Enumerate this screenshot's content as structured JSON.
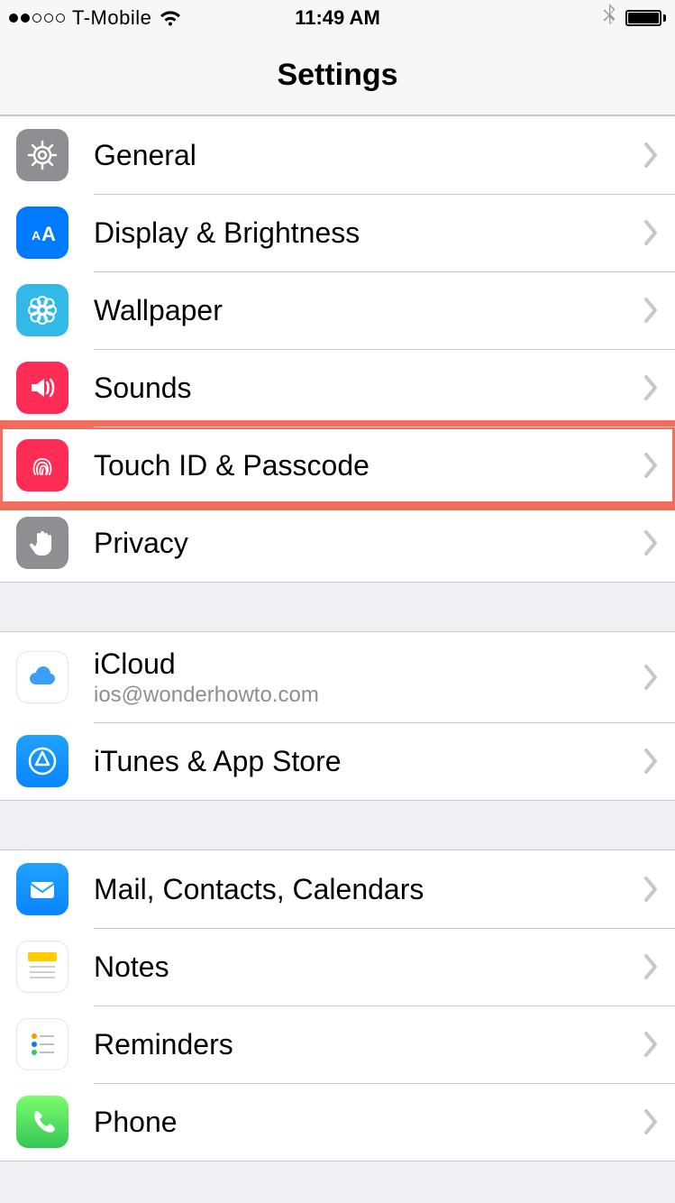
{
  "status": {
    "carrier": "T-Mobile",
    "time": "11:49 AM"
  },
  "header": {
    "title": "Settings"
  },
  "groups": [
    {
      "rows": [
        {
          "id": "general",
          "label": "General",
          "icon": "gear-icon",
          "bg": "bg-gray",
          "highlight": false
        },
        {
          "id": "display",
          "label": "Display & Brightness",
          "icon": "text-size-icon",
          "bg": "bg-blue",
          "highlight": false
        },
        {
          "id": "wallpaper",
          "label": "Wallpaper",
          "icon": "flower-icon",
          "bg": "bg-cyan",
          "highlight": false
        },
        {
          "id": "sounds",
          "label": "Sounds",
          "icon": "speaker-icon",
          "bg": "bg-redpink",
          "highlight": false
        },
        {
          "id": "touchid",
          "label": "Touch ID & Passcode",
          "icon": "fingerprint-icon",
          "bg": "bg-redpink",
          "highlight": true
        },
        {
          "id": "privacy",
          "label": "Privacy",
          "icon": "hand-icon",
          "bg": "bg-gray",
          "highlight": false
        }
      ]
    },
    {
      "rows": [
        {
          "id": "icloud",
          "label": "iCloud",
          "sub": "ios@wonderhowto.com",
          "icon": "cloud-icon",
          "bg": "bg-white",
          "highlight": false
        },
        {
          "id": "itunes",
          "label": "iTunes & App Store",
          "icon": "appstore-icon",
          "bg": "bg-bluegrad",
          "highlight": false
        }
      ]
    },
    {
      "rows": [
        {
          "id": "mail",
          "label": "Mail, Contacts, Calendars",
          "icon": "mail-icon",
          "bg": "bg-bluegrad",
          "highlight": false
        },
        {
          "id": "notes",
          "label": "Notes",
          "icon": "notes-icon",
          "bg": "bg-notes",
          "highlight": false
        },
        {
          "id": "reminders",
          "label": "Reminders",
          "icon": "reminders-icon",
          "bg": "bg-rem",
          "highlight": false
        },
        {
          "id": "phone",
          "label": "Phone",
          "icon": "phone-icon",
          "bg": "bg-green",
          "highlight": false
        }
      ]
    }
  ]
}
